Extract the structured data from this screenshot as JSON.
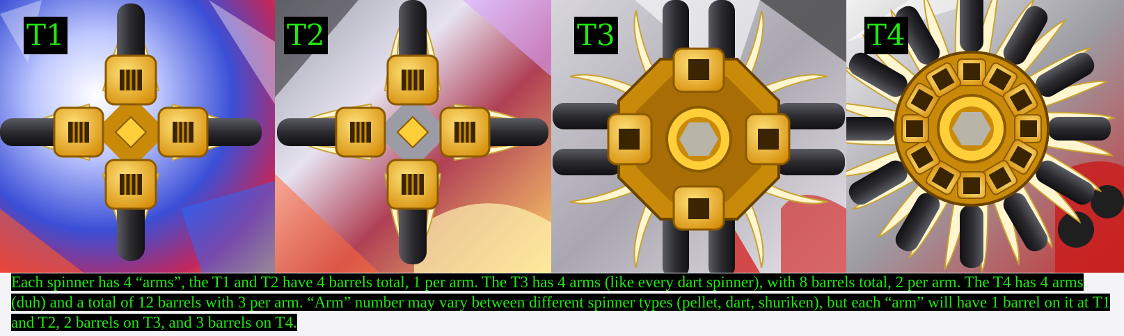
{
  "panels": [
    {
      "label": "T1",
      "barrels_per_arm": 1
    },
    {
      "label": "T2",
      "barrels_per_arm": 1
    },
    {
      "label": "T3",
      "barrels_per_arm": 2
    },
    {
      "label": "T4",
      "barrels_per_arm": 3
    }
  ],
  "caption": "Each spinner has 4 “arms”, the T1 and T2 have 4 barrels total, 1 per arm. The T3 has 4 arms (like every dart spinner), with 8 barrels total, 2 per arm. The T4 has 4 arms (duh) and a total of 12 barrels with 3 per arm. “Arm” number may vary between different spinner types (pellet, dart, shuriken), but each “arm” will have 1 barrel on it at T1 and T2, 2 barrels on T3, and 3 barrels on T4.",
  "colors": {
    "label_text": "#22e612",
    "label_bg": "#000000",
    "turret_gold": "#f2b51a",
    "barrel_dark": "#2b2b30"
  }
}
